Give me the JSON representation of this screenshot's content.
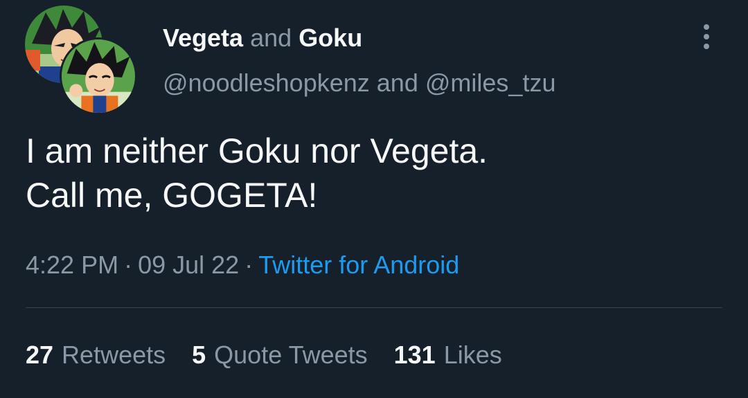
{
  "header": {
    "name_1": "Vegeta",
    "conjunction": "and",
    "name_2": "Goku",
    "handle_1": "@noodleshopkenz",
    "handle_conjunction": "and",
    "handle_2": "@miles_tzu"
  },
  "tweet": {
    "line_1": "I am neither Goku nor Vegeta.",
    "line_2": "Call me, GOGETA!"
  },
  "meta": {
    "time": "4:22 PM",
    "separator": "·",
    "date": "09 Jul 22",
    "source": "Twitter for Android"
  },
  "stats": {
    "retweets_count": "27",
    "retweets_label": "Retweets",
    "quotes_count": "5",
    "quotes_label": "Quote Tweets",
    "likes_count": "131",
    "likes_label": "Likes"
  },
  "icons": {
    "more": "more-vertical-icon"
  },
  "colors": {
    "background": "#15202b",
    "primary_text": "#f7f9f9",
    "secondary_text": "#8b98a5",
    "link": "#1d9bf0",
    "divider": "#38444d"
  }
}
